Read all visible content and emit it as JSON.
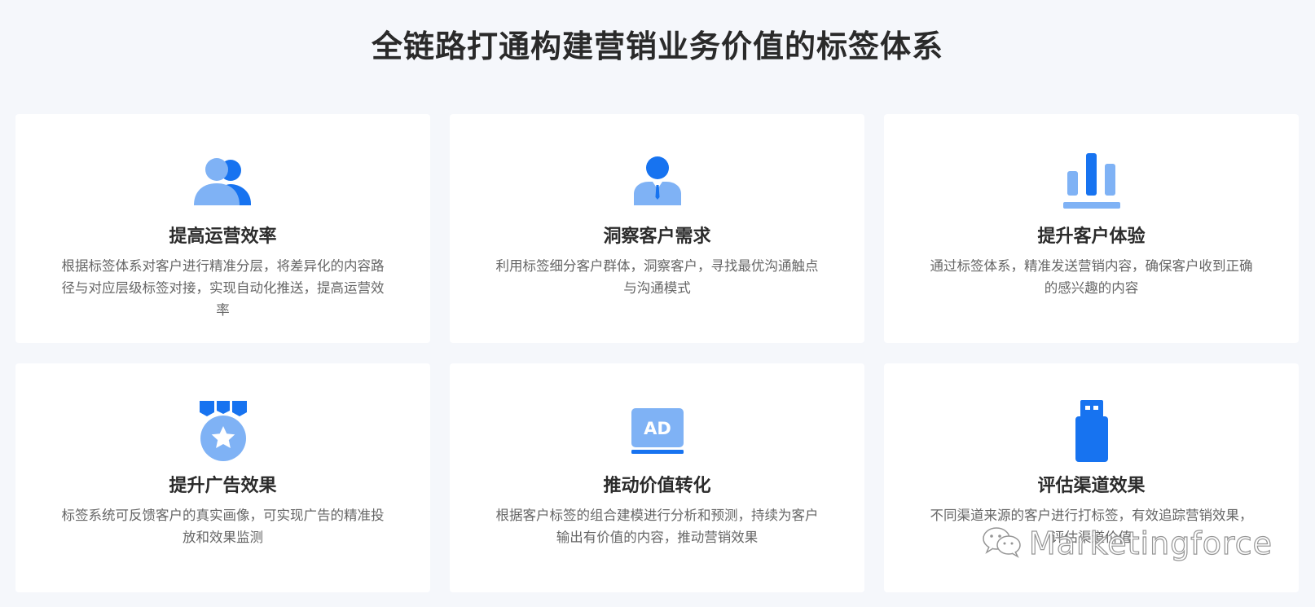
{
  "page": {
    "title": "全链路打通构建营销业务价值的标签体系"
  },
  "colors": {
    "primary": "#1773f0",
    "light": "#7fb2f5",
    "background": "#f5f7fb",
    "card": "#ffffff"
  },
  "cards": [
    {
      "icon": "users-icon",
      "title": "提高运营效率",
      "description": "根据标签体系对客户进行精准分层，将差异化的内容路径与对应层级标签对接，实现自动化推送，提高运营效率"
    },
    {
      "icon": "customer-icon",
      "title": "洞察客户需求",
      "description": "利用标签细分客户群体，洞察客户，寻找最优沟通触点与沟通模式"
    },
    {
      "icon": "bar-chart-icon",
      "title": "提升客户体验",
      "description": "通过标签体系，精准发送营销内容，确保客户收到正确的感兴趣的内容"
    },
    {
      "icon": "medal-icon",
      "title": "提升广告效果",
      "description": "标签系统可反馈客户的真实画像，可实现广告的精准投放和效果监测"
    },
    {
      "icon": "ad-icon",
      "title": "推动价值转化",
      "description": "根据客户标签的组合建模进行分析和预测，持续为客户输出有价值的内容，推动营销效果"
    },
    {
      "icon": "usb-icon",
      "title": "评估渠道效果",
      "description": "不同渠道来源的客户进行打标签，有效追踪营销效果，评估渠道价值"
    }
  ],
  "watermark": {
    "icon": "wechat-icon",
    "text": "Marketingforce"
  }
}
